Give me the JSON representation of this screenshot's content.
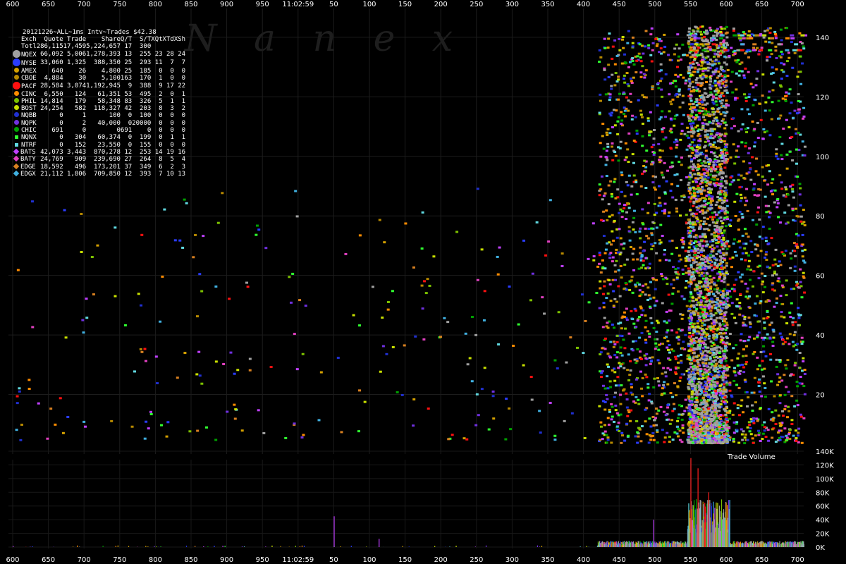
{
  "chart_data": [
    {
      "type": "scatter",
      "title": "",
      "xlabel": "",
      "ylabel": "",
      "x_ticks_ms": [
        "600",
        "650",
        "700",
        "750",
        "800",
        "850",
        "900",
        "950",
        "11:02:59",
        "50",
        "100",
        "150",
        "200",
        "250",
        "300",
        "350",
        "400",
        "450",
        "500",
        "550",
        "600",
        "650",
        "700"
      ],
      "y_ticks": [
        "20",
        "40",
        "60",
        "80",
        "100",
        "120",
        "140"
      ],
      "ylim": [
        0,
        144
      ],
      "watermark": "N a n e x",
      "description_of_series": "Each colored square is a quote/trade event plotted at its millisecond time and ms-interval count; colors follow the exchange legend.",
      "density_profile_ms": {
        "sparse_range": [
          "11:02:58.600",
          "11:02:59.420"
        ],
        "dense_range": [
          "11:02:59.420",
          "11:02:59.715"
        ],
        "heaviest_range": [
          "11:02:59.545",
          "11:02:59.600"
        ]
      }
    },
    {
      "type": "bar",
      "title": "Trade Volume",
      "y_ticks": [
        "0K",
        "20K",
        "40K",
        "60K",
        "80K",
        "100K",
        "120K",
        "140K"
      ],
      "ylim": [
        0,
        140000
      ],
      "x_ticks_ms": [
        "600",
        "650",
        "700",
        "750",
        "800",
        "850",
        "900",
        "950",
        "11:02:59",
        "50",
        "100",
        "150",
        "200",
        "250",
        "300",
        "350",
        "400",
        "450",
        "500",
        "550",
        "600",
        "650",
        "700"
      ],
      "notable_spikes": [
        {
          "x": "11:02:59.050",
          "value": 45000
        },
        {
          "x": "11:02:59.113",
          "value": 12000
        },
        {
          "x": "11:02:59.498",
          "value": 40000
        },
        {
          "x": "11:02:59.550",
          "value": 130000
        },
        {
          "x": "11:02:59.560",
          "value": 115000
        },
        {
          "x": "11:02:59.575",
          "value": 80000
        }
      ]
    }
  ],
  "stats": {
    "title": "20121226~ALL~1ms Intv~Trades $42.38",
    "headers": [
      "Exch",
      "Quote",
      "Trade",
      "Share",
      "Q/T",
      "S/T",
      "XQt",
      "XTd",
      "XSh"
    ],
    "total": [
      "Totl",
      "286,115",
      "17,459",
      "5,224,657",
      "17",
      "300",
      "",
      "",
      ""
    ],
    "rows": [
      {
        "sym": "circle-big",
        "color": "#a0a0a0",
        "cells": [
          "NQEX",
          "66,092",
          "5,006",
          "1,278,393",
          "13",
          "255",
          "23",
          "28",
          "24"
        ]
      },
      {
        "sym": "circle-big",
        "color": "#2a3cff",
        "cells": [
          "NYSE",
          "33,060",
          "1,325",
          "388,350",
          "25",
          "293",
          "11",
          "7",
          "7"
        ]
      },
      {
        "sym": "circle",
        "color": "#d4a000",
        "cells": [
          "AMEX",
          "640",
          "26",
          "4,800",
          "25",
          "185",
          "0",
          "0",
          "0"
        ]
      },
      {
        "sym": "circle",
        "color": "#b88a00",
        "cells": [
          "CBOE",
          "4,884",
          "30",
          "5,100",
          "163",
          "170",
          "1",
          "0",
          "0"
        ]
      },
      {
        "sym": "circle-big",
        "color": "#ff1010",
        "cells": [
          "PACF",
          "28,584",
          "3,074",
          "1,192,945",
          "9",
          "388",
          "9",
          "17",
          "22"
        ]
      },
      {
        "sym": "circle",
        "color": "#ff8c00",
        "cells": [
          "CINC",
          "6,550",
          "124",
          "61,351",
          "53",
          "495",
          "2",
          "0",
          "1"
        ]
      },
      {
        "sym": "circle",
        "color": "#7cc000",
        "cells": [
          "PHIL",
          "14,814",
          "179",
          "58,348",
          "83",
          "326",
          "5",
          "1",
          "1"
        ]
      },
      {
        "sym": "circle",
        "color": "#c8e000",
        "cells": [
          "BOST",
          "24,254",
          "582",
          "118,327",
          "42",
          "203",
          "8",
          "3",
          "2"
        ]
      },
      {
        "sym": "circle",
        "color": "#2030d0",
        "cells": [
          "NQBB",
          "0",
          "1",
          "100",
          "0",
          "100",
          "0",
          "0",
          "0"
        ]
      },
      {
        "sym": "circle",
        "color": "#7030e0",
        "cells": [
          "NQPK",
          "0",
          "2",
          "40,000",
          "0",
          "20000",
          "0",
          "0",
          "0"
        ]
      },
      {
        "sym": "circle",
        "color": "#00a000",
        "cells": [
          "CHIC",
          "691",
          "0",
          "0",
          "691",
          "0",
          "0",
          "0",
          "0"
        ]
      },
      {
        "sym": "square",
        "color": "#30ff30",
        "cells": [
          "NQNX",
          "0",
          "304",
          "60,374",
          "0",
          "199",
          "0",
          "1",
          "1"
        ]
      },
      {
        "sym": "square",
        "color": "#60d8e0",
        "cells": [
          "NTRF",
          "0",
          "152",
          "23,550",
          "0",
          "155",
          "0",
          "0",
          "0"
        ]
      },
      {
        "sym": "diamond",
        "color": "#c040ff",
        "cells": [
          "BATS",
          "42,073",
          "3,443",
          "870,278",
          "12",
          "253",
          "14",
          "19",
          "16"
        ]
      },
      {
        "sym": "diamond",
        "color": "#e040c0",
        "cells": [
          "BATY",
          "24,769",
          "909",
          "239,690",
          "27",
          "264",
          "8",
          "5",
          "4"
        ]
      },
      {
        "sym": "diamond",
        "color": "#d88020",
        "cells": [
          "EDGE",
          "18,592",
          "496",
          "173,201",
          "37",
          "349",
          "6",
          "2",
          "3"
        ]
      },
      {
        "sym": "diamond",
        "color": "#40b0e0",
        "cells": [
          "EDGX",
          "21,112",
          "1,806",
          "709,850",
          "12",
          "393",
          "7",
          "10",
          "13"
        ]
      }
    ]
  },
  "colors": {
    "background": "#000000",
    "text": "#ffffff",
    "grid": "#1e1e1e",
    "watermark": "#1e1e1e"
  }
}
